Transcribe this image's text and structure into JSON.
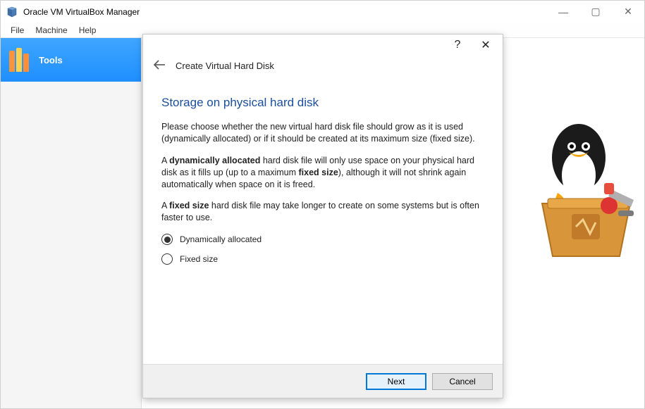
{
  "titlebar": {
    "title": "Oracle VM VirtualBox Manager"
  },
  "menubar": {
    "file": "File",
    "machine": "Machine",
    "help": "Help"
  },
  "sidebar": {
    "tools_label": "Tools"
  },
  "dialog": {
    "help_char": "?",
    "close_char": "✕",
    "title": "Create Virtual Hard Disk",
    "heading": "Storage on physical hard disk",
    "p1_a": "Please choose whether the new virtual hard disk file should grow as it is used (dynamically allocated) or if it should be created at its maximum size (fixed size).",
    "p2_pre": "A ",
    "p2_b": "dynamically allocated",
    "p2_mid": " hard disk file will only use space on your physical hard disk as it fills up (up to a maximum ",
    "p2_b2": "fixed size",
    "p2_post": "), although it will not shrink again automatically when space on it is freed.",
    "p3_pre": "A ",
    "p3_b": "fixed size",
    "p3_post": " hard disk file may take longer to create on some systems but is often faster to use.",
    "radios": {
      "dynamic_label": "Dynamically allocated",
      "fixed_label": "Fixed size",
      "selected": "dynamic"
    },
    "buttons": {
      "next": "Next",
      "cancel": "Cancel"
    }
  },
  "win_controls": {
    "min": "—",
    "max": "▢",
    "close": "✕"
  }
}
